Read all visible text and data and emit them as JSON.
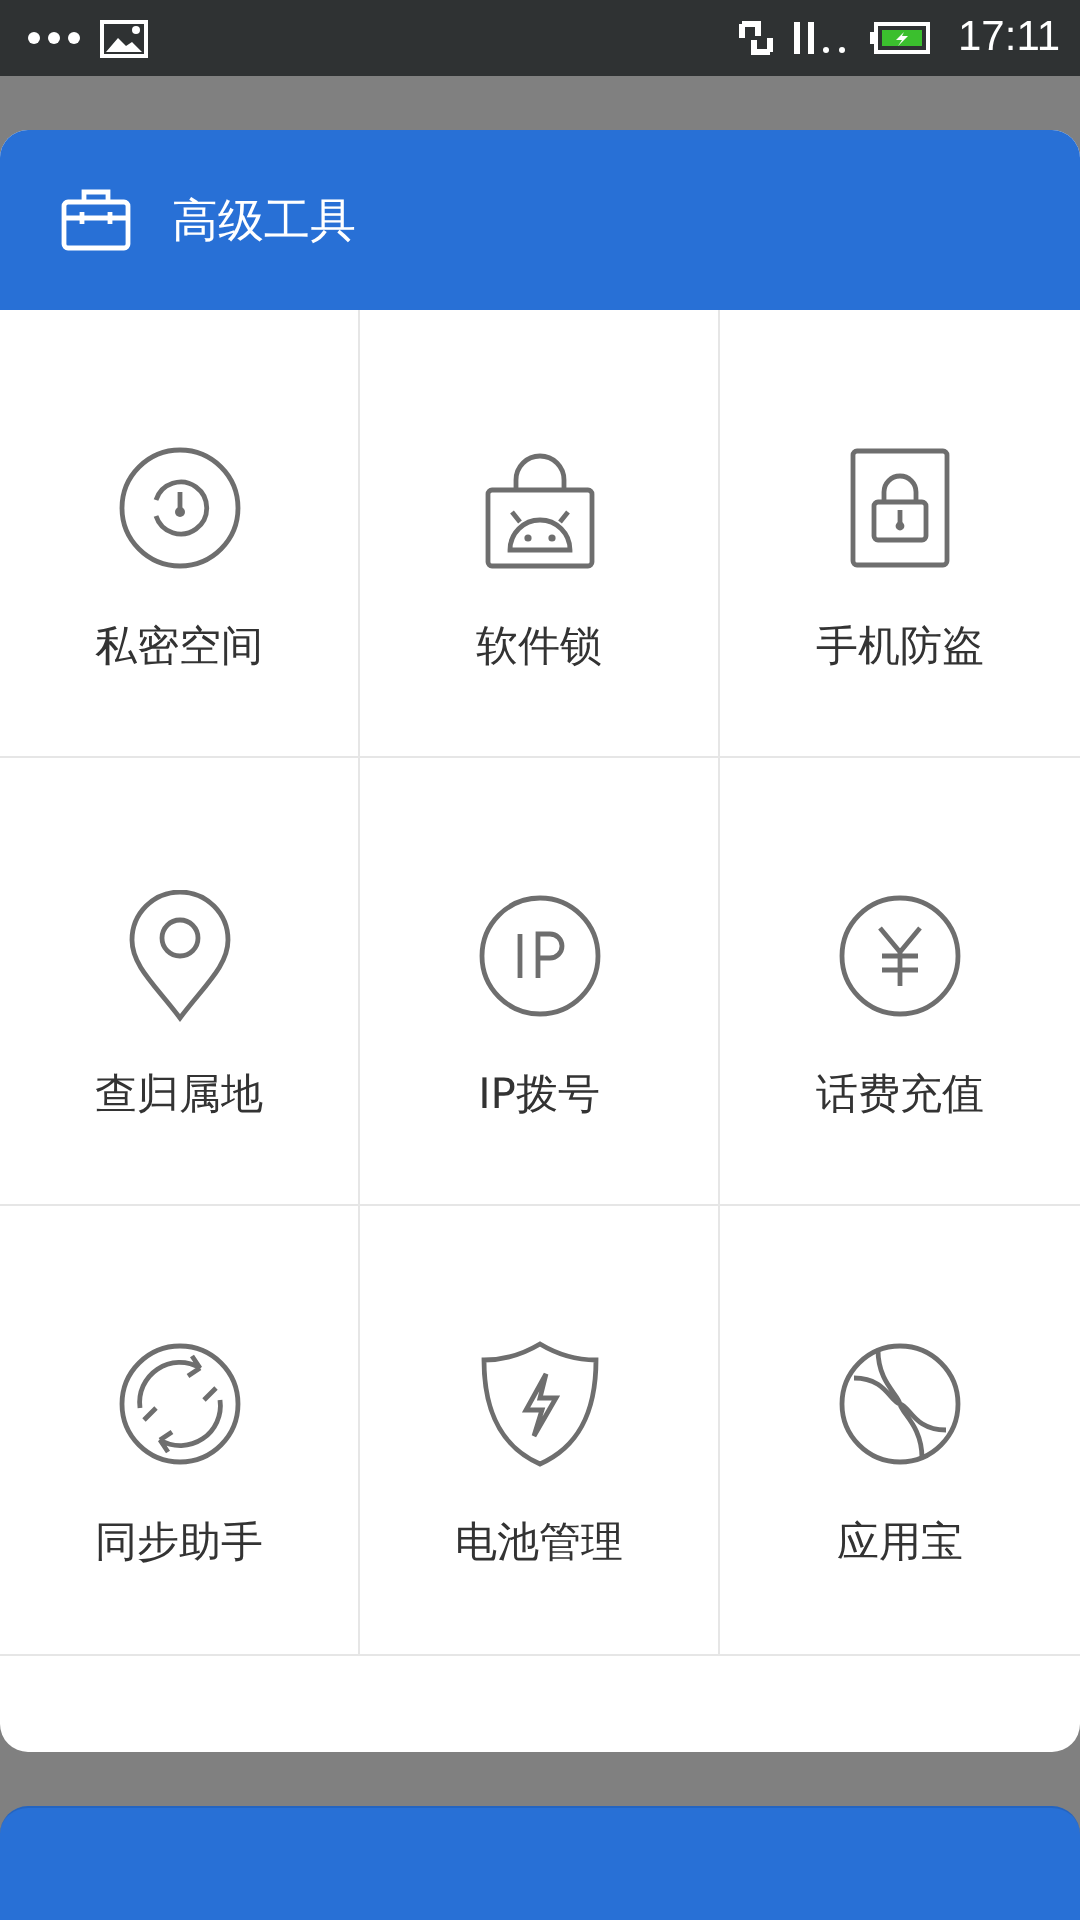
{
  "status_bar": {
    "time": "17:11"
  },
  "dialog": {
    "title": "高级工具",
    "tools": [
      {
        "label": "私密空间"
      },
      {
        "label": "软件锁"
      },
      {
        "label": "手机防盗"
      },
      {
        "label": "查归属地"
      },
      {
        "label": "IP拨号"
      },
      {
        "label": "话费充值"
      },
      {
        "label": "同步助手"
      },
      {
        "label": "电池管理"
      },
      {
        "label": "应用宝"
      }
    ]
  }
}
